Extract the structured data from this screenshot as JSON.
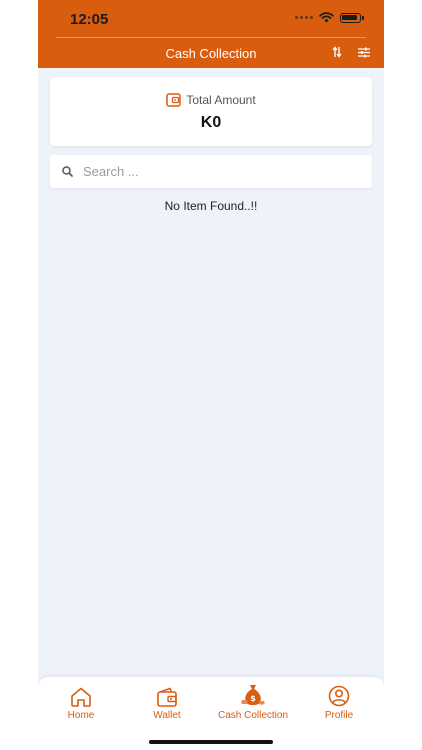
{
  "status_bar": {
    "time": "12:05"
  },
  "header": {
    "title": "Cash Collection"
  },
  "total_card": {
    "label": "Total Amount",
    "value": "K0"
  },
  "search": {
    "placeholder": "Search ..."
  },
  "empty_state": {
    "message": "No Item Found..!!"
  },
  "tabs": [
    {
      "label": "Home",
      "icon": "home-icon"
    },
    {
      "label": "Wallet",
      "icon": "wallet-icon"
    },
    {
      "label": "Cash Collection",
      "icon": "money-bag-icon",
      "active": true
    },
    {
      "label": "Profile",
      "icon": "profile-icon"
    }
  ],
  "colors": {
    "accent": "#d95d0f",
    "background": "#eef2f9",
    "card": "#ffffff"
  }
}
